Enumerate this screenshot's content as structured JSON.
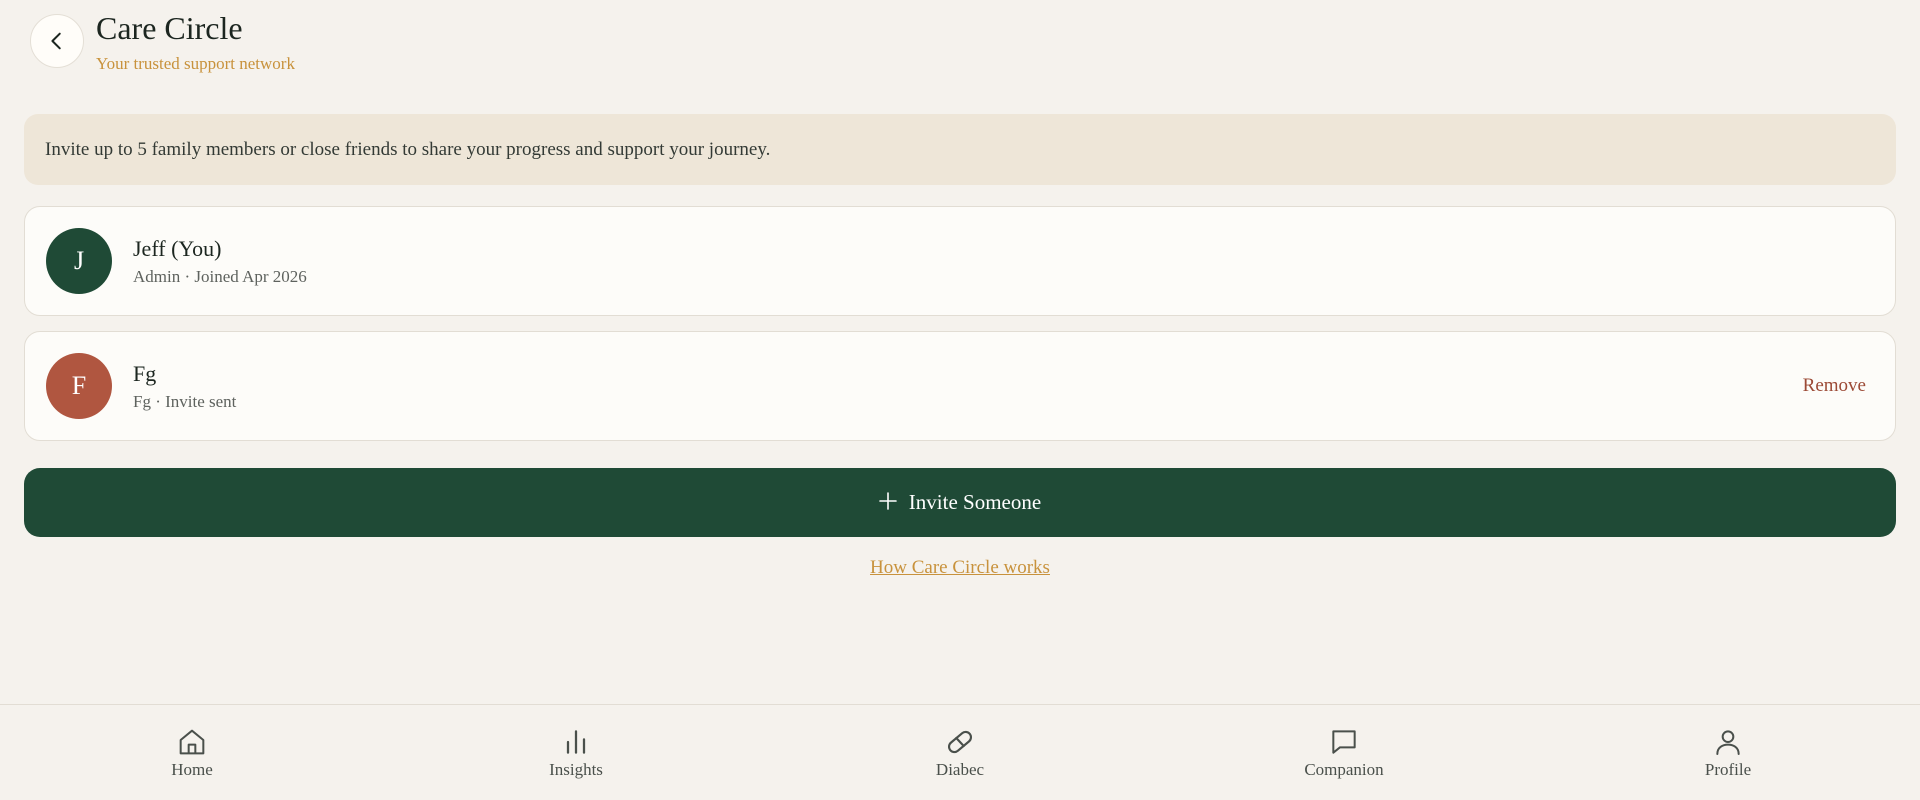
{
  "header": {
    "back_icon": "chevron-left-icon",
    "title": "Care Circle",
    "subtitle": "Your trusted support network"
  },
  "info_banner": {
    "text": "Invite up to 5 family members or close friends to share your progress and support your journey."
  },
  "members": [
    {
      "initial": "J",
      "name": "Jeff (You)",
      "meta": "Admin · Joined Apr 2026",
      "avatar_color": "#1f4a36"
    },
    {
      "initial": "F",
      "name": "Fg",
      "meta": "Fg · Invite sent",
      "avatar_color": "#b05640",
      "action_label": "Remove"
    }
  ],
  "invite_button": {
    "icon": "plus-icon",
    "label": "Invite Someone"
  },
  "help_link": {
    "label": "How Care Circle works"
  },
  "nav": {
    "items": [
      {
        "label": "Home",
        "icon": "home-icon"
      },
      {
        "label": "Insights",
        "icon": "bar-chart-icon"
      },
      {
        "label": "Diabec",
        "icon": "pill-icon"
      },
      {
        "label": "Companion",
        "icon": "chat-bubble-icon"
      },
      {
        "label": "Profile",
        "icon": "user-icon"
      }
    ]
  },
  "colors": {
    "background": "#f5f2ed",
    "primary": "#1f4a36",
    "accent": "#c8923c",
    "danger": "#9c4a36",
    "banner": "#eee6d8"
  }
}
